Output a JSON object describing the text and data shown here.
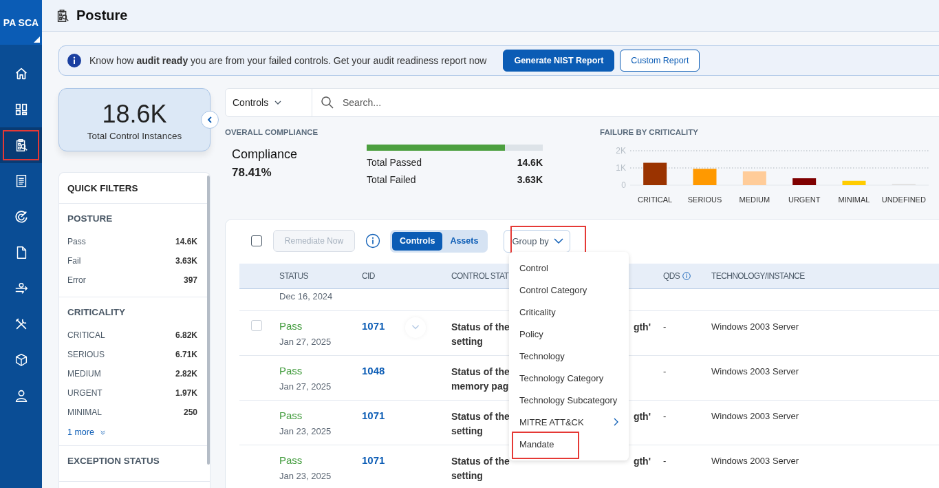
{
  "app": {
    "logo": "PA SCA"
  },
  "nav": [
    {
      "kind": "home",
      "selected": false,
      "annotated": false
    },
    {
      "kind": "dashboard",
      "selected": false,
      "annotated": false
    },
    {
      "kind": "posture",
      "selected": true,
      "annotated": true
    },
    {
      "kind": "report",
      "selected": false,
      "annotated": false
    },
    {
      "kind": "radar",
      "selected": false,
      "annotated": false
    },
    {
      "kind": "document",
      "selected": false,
      "annotated": false
    },
    {
      "kind": "pipeline",
      "selected": false,
      "annotated": false
    },
    {
      "kind": "tools",
      "selected": false,
      "annotated": false
    },
    {
      "kind": "cube",
      "selected": false,
      "annotated": false
    },
    {
      "kind": "user",
      "selected": false,
      "annotated": false
    }
  ],
  "page": {
    "title": "Posture"
  },
  "banner": {
    "text": "Know how **audit ready** you are from your failed controls. Get your audit readiness report now",
    "buttons": [
      {
        "label": "Generate NIST Report",
        "kind": "primary"
      },
      {
        "label": "Custom Report",
        "kind": "secondary"
      }
    ]
  },
  "summary": {
    "value": "18.6K",
    "label": "Total Control Instances"
  },
  "quick_filters": {
    "title": "QUICK FILTERS",
    "sections": [
      {
        "title": "POSTURE",
        "items": [
          {
            "label": "Pass",
            "count": "14.6K"
          },
          {
            "label": "Fail",
            "count": "3.63K"
          },
          {
            "label": "Error",
            "count": "397"
          }
        ]
      },
      {
        "title": "CRITICALITY",
        "items": [
          {
            "label": "CRITICAL",
            "count": "6.82K"
          },
          {
            "label": "SERIOUS",
            "count": "6.71K"
          },
          {
            "label": "MEDIUM",
            "count": "2.82K"
          },
          {
            "label": "URGENT",
            "count": "1.97K"
          },
          {
            "label": "MINIMAL",
            "count": "250"
          }
        ],
        "more": "1 more"
      },
      {
        "title": "EXCEPTION STATUS"
      }
    ]
  },
  "search": {
    "scope": "Controls",
    "placeholder": "Search..."
  },
  "compliance": {
    "heading": "OVERALL COMPLIANCE",
    "label": "Compliance",
    "value": "78.41%",
    "level": 0.7841,
    "stats": [
      {
        "label": "Total Passed",
        "value": "14.6K"
      },
      {
        "label": "Total Failed",
        "value": "3.63K"
      }
    ]
  },
  "failure": {
    "heading": "FAILURE BY CRITICALITY",
    "chart_data": {
      "type": "bar",
      "categories": [
        "CRITICAL",
        "SERIOUS",
        "MEDIUM",
        "URGENT",
        "MINIMAL",
        "UNDEFINED"
      ],
      "values": [
        1300,
        950,
        800,
        400,
        250,
        20
      ],
      "colors": [
        "#9a3300",
        "#ff9900",
        "#ffcc99",
        "#7f0000",
        "#ffcc00",
        "#e2e2e2"
      ],
      "ylim": [
        0,
        2000
      ],
      "yticks": [
        0,
        {
          "value": 1000,
          "label": "1K"
        },
        {
          "value": 2000,
          "label": "2K"
        }
      ]
    }
  },
  "toolbar": {
    "select_all_checked": false,
    "remediate": {
      "label": "Remediate Now",
      "disabled": true
    },
    "view_toggle": [
      {
        "label": "Controls",
        "selected": true
      },
      {
        "label": "Assets",
        "selected": false
      }
    ],
    "group_by": {
      "label": "Group by",
      "expanded": true,
      "annotated": true
    }
  },
  "group_menu": [
    {
      "label": "Control",
      "submenu": false,
      "annotated": false
    },
    {
      "label": "Control Category",
      "submenu": false,
      "annotated": false
    },
    {
      "label": "Criticality",
      "submenu": false,
      "annotated": false
    },
    {
      "label": "Policy",
      "submenu": false,
      "annotated": false
    },
    {
      "label": "Technology",
      "submenu": false,
      "annotated": false
    },
    {
      "label": "Technology Category",
      "submenu": false,
      "annotated": false
    },
    {
      "label": "Technology Subcategory",
      "submenu": false,
      "annotated": false
    },
    {
      "label": "MITRE ATT&CK",
      "submenu": true,
      "annotated": false
    },
    {
      "label": "Mandate",
      "submenu": false,
      "annotated": true
    }
  ],
  "table": {
    "columns": [
      "STATUS",
      "CID",
      "CONTROL STAT",
      "QDS",
      "TECHNOLOGY/INSTANCE"
    ],
    "partial_row": {
      "date": "Dec 16, 2024"
    },
    "rows": [
      {
        "status": "Pass",
        "date": "Jan 27, 2025",
        "cid": "1071",
        "statement": [
          "Status of the",
          "setting"
        ],
        "statement_tail": "gth'",
        "qds": "-",
        "technology": "Windows 2003 Server",
        "hovered": true
      },
      {
        "status": "Pass",
        "date": "Jan 27, 2025",
        "cid": "1048",
        "statement": [
          "Status of the",
          "memory pag"
        ],
        "qds": "-",
        "technology": "Windows 2003 Server",
        "hovered": false
      },
      {
        "status": "Pass",
        "date": "Jan 23, 2025",
        "cid": "1071",
        "statement": [
          "Status of the",
          "setting"
        ],
        "statement_tail": "gth'",
        "qds": "-",
        "technology": "Windows 2003 Server",
        "hovered": false
      },
      {
        "status": "Pass",
        "date": "Jan 23, 2025",
        "cid": "1071",
        "statement": [
          "Status of the",
          "setting"
        ],
        "statement_tail": "gth'",
        "qds": "-",
        "technology": "Windows 2003 Server",
        "hovered": false
      }
    ]
  }
}
